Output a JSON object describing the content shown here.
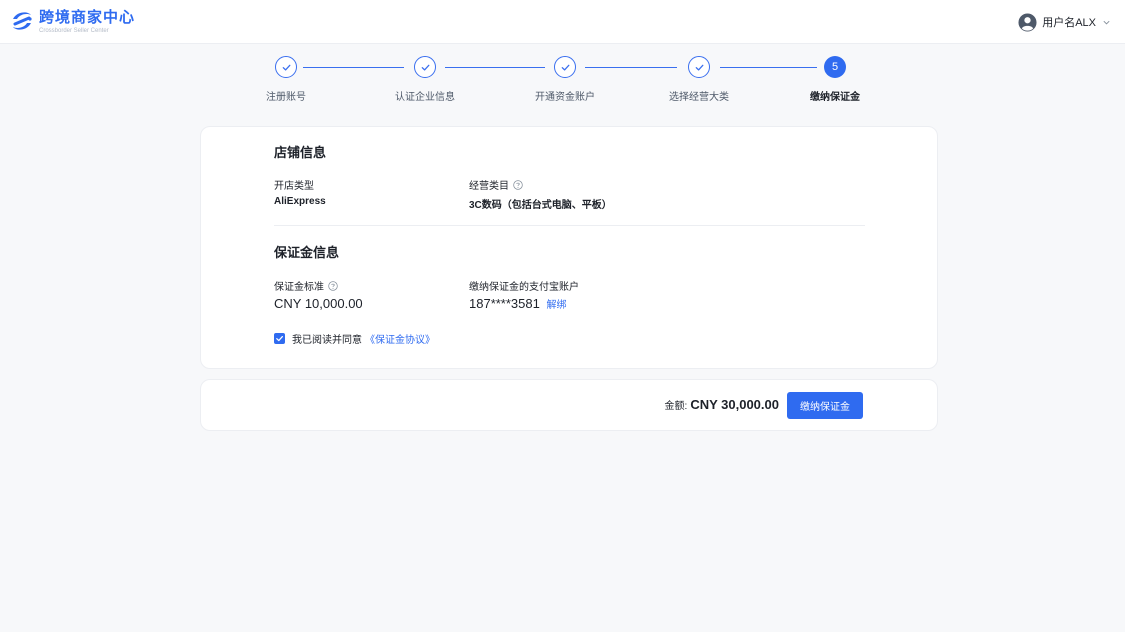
{
  "header": {
    "brand_title": "跨境商家中心",
    "brand_subtitle": "Crossborder Seller Center",
    "user_name": "用户名ALX"
  },
  "steps": [
    {
      "label": "注册账号",
      "status": "done"
    },
    {
      "label": "认证企业信息",
      "status": "done"
    },
    {
      "label": "开通资金账户",
      "status": "done"
    },
    {
      "label": "选择经营大类",
      "status": "done"
    },
    {
      "label": "缴纳保证金",
      "status": "active",
      "number": "5"
    }
  ],
  "store_info": {
    "title": "店铺信息",
    "shop_type_label": "开店类型",
    "shop_type_value": "AliExpress",
    "category_label": "经营类目",
    "category_value": "3C数码（包括台式电脑、平板）"
  },
  "deposit_info": {
    "title": "保证金信息",
    "standard_label": "保证金标准",
    "standard_value": "CNY 10,000.00",
    "account_label": "缴纳保证金的支付宝账户",
    "account_value": "187****3581",
    "unbind_link": "解绑",
    "agree_text": "我已阅读并同意",
    "agree_link": "《保证金协议》",
    "agree_checked": true
  },
  "payment": {
    "amount_label": "金额:",
    "amount_value": "CNY 30,000.00",
    "pay_button": "缴纳保证金"
  },
  "colors": {
    "accent": "#2f6bf0",
    "background": "#f7f8fa",
    "text": "#1d2129"
  }
}
